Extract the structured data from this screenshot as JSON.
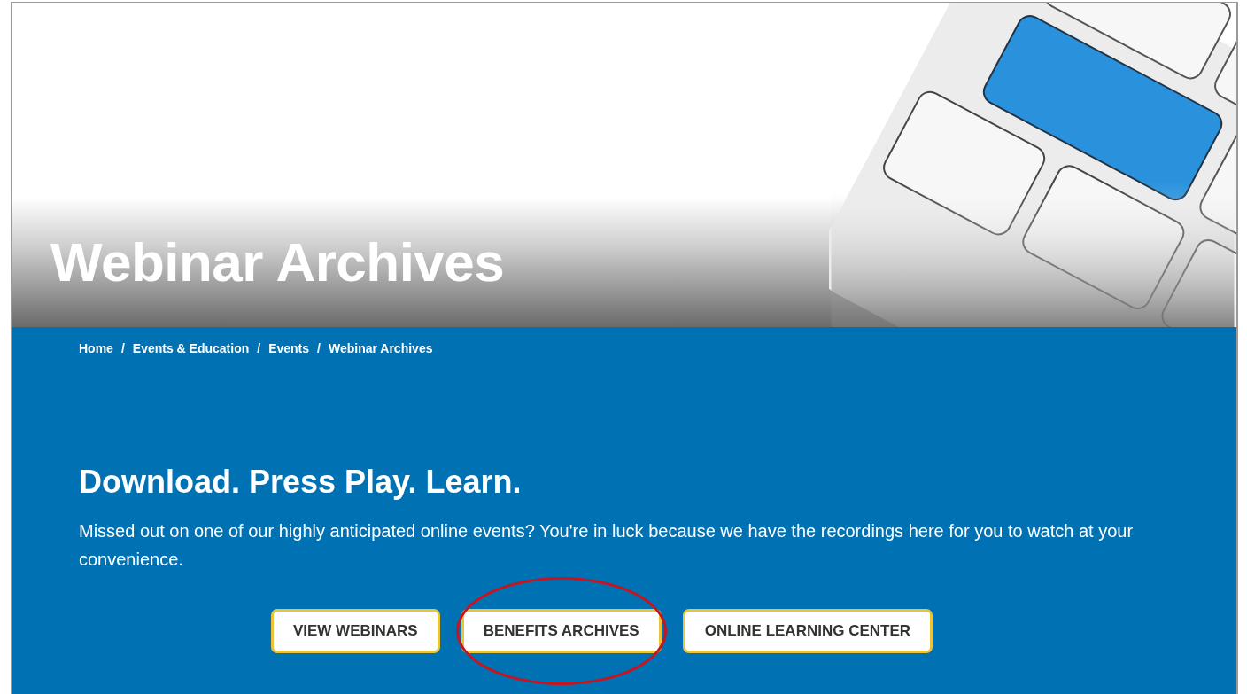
{
  "hero": {
    "title": "Webinar Archives"
  },
  "breadcrumb": [
    {
      "label": "Home"
    },
    {
      "label": "Events & Education"
    },
    {
      "label": "Events"
    },
    {
      "label": "Webinar Archives"
    }
  ],
  "breadcrumb_separator": "/",
  "heading": "Download. Press Play. Learn.",
  "intro": "Missed out on one of our highly anticipated online events? You're in luck because we have the recordings here for you to watch at your convenience.",
  "buttons": [
    {
      "label": "VIEW WEBINARS",
      "circled": false
    },
    {
      "label": "BENEFITS ARCHIVES",
      "circled": true
    },
    {
      "label": "ONLINE LEARNING CENTER",
      "circled": false
    }
  ]
}
